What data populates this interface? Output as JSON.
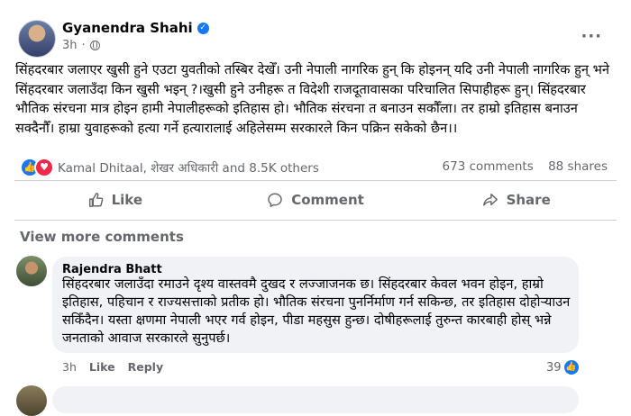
{
  "post": {
    "author": "Gyanendra Shahi",
    "time": "3h",
    "paragraph": "सिंहदरबार जलाएर खुसी हुने एउटा युवतीको तस्बिर देखेँ। उनी नेपाली नागरिक हुन् कि होइनन् यदि उनी नेपाली नागरिक हुन् भने सिंहदरबार जलाउँदा किन खुसी भइन् ?।खुसी हुने उनीहरू त विदेशी राजदूतावासका परिचालित सिपाहीहरू हुन्। सिंहदरबार भौतिक संरचना मात्र होइन हामी नेपालीहरूको इतिहास हो। भौतिक संरचना त बनाउन सकौँला। तर हाम्रो इतिहास बनाउन सक्दैनौँ। हाम्रा युवाहरूको हत्या गर्ने हत्यारालाई अहिलेसम्म सरकारले किन पक्रिन सकेको छैन।।"
  },
  "stats": {
    "reactors": "Kamal Dhitaal, शेखर अधिकारी and 8.5K others",
    "comments": "673 comments",
    "shares": "88 shares"
  },
  "actions": {
    "like": "Like",
    "comment": "Comment",
    "share": "Share"
  },
  "view_more": "View more comments",
  "comment": {
    "author": "Rajendra Bhatt",
    "text": "सिंहदरबार जलाउँदा रमाउने दृश्य वास्तवमै दुखद र लज्जाजनक छ। सिंहदरबार केवल भवन होइन, हाम्रो इतिहास, पहिचान र राज्यसत्ताको प्रतीक हो। भौतिक संरचना पुनर्निर्माण गर्न सकिन्छ, तर इतिहास दोहोर्‍याउन सकिँदैन। यस्ता क्षणमा नेपाली भएर गर्व होइन, पीडा महसुस हुन्छ। दोषीहरूलाई तुरुन्त कारबाही होस् भन्ने जनताको आवाज सरकारले सुनुपर्छ।",
    "time": "3h",
    "like": "Like",
    "reply": "Reply",
    "reactions": "39"
  },
  "icons": {
    "verified": "verified-badge-icon",
    "globe": "globe-icon",
    "more": "more-options-icon"
  },
  "colors": {
    "accent": "#1877f2",
    "love": "#f02849",
    "muted": "#65676b",
    "bubble": "#f0f2f5"
  }
}
